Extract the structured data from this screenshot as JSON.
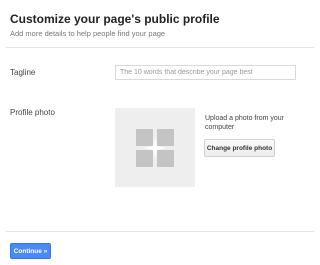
{
  "header": {
    "title": "Customize your page's public profile",
    "subtitle": "Add more details to help people find your page"
  },
  "tagline": {
    "label": "Tagline",
    "placeholder": "The 10 words that describe your page best",
    "value": ""
  },
  "profile_photo": {
    "label": "Profile photo",
    "upload_text": "Upload a photo from your computer",
    "change_button": "Change profile photo",
    "placeholder_icon": "photo-placeholder-icon"
  },
  "footer": {
    "continue_button": "Continue »"
  },
  "colors": {
    "primary_button": "#4a8af4",
    "photo_placeholder_bg": "#eeeeee",
    "photo_icon": "#c4c4c4"
  }
}
